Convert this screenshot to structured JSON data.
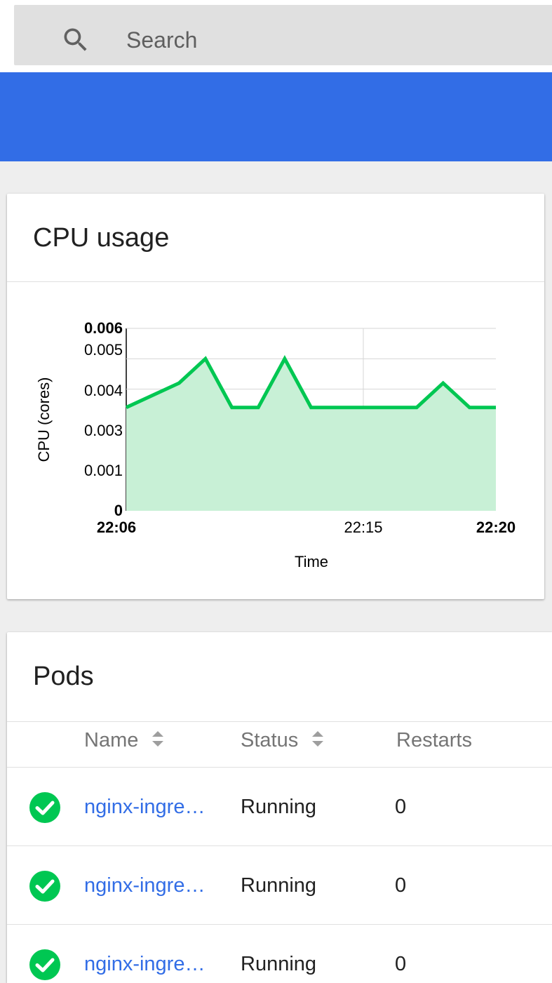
{
  "search": {
    "placeholder": "Search"
  },
  "colors": {
    "brand_blue": "#326de6",
    "ok_green": "#00c752",
    "area_fill": "#c8f0d6"
  },
  "cpu_card": {
    "title": "CPU usage"
  },
  "chart_data": {
    "type": "area",
    "title": "",
    "xlabel": "Time",
    "ylabel": "CPU (cores)",
    "x_ticks": [
      "22:06",
      "22:15",
      "22:20"
    ],
    "y_ticks": [
      "0",
      "0.001",
      "0.003",
      "0.004",
      "0.005",
      "0.006"
    ],
    "ylim": [
      0,
      0.006
    ],
    "grid": true,
    "series": [
      {
        "x": [
          "22:06",
          "22:08",
          "22:09",
          "22:10",
          "22:11",
          "22:12",
          "22:13",
          "22:14",
          "22:15",
          "22:16",
          "22:17",
          "22:18",
          "22:19",
          "22:20"
        ],
        "values": [
          0.0034,
          0.0042,
          0.005,
          0.0034,
          0.0034,
          0.005,
          0.0034,
          0.0034,
          0.0034,
          0.0034,
          0.0034,
          0.0042,
          0.0034,
          0.0034
        ]
      }
    ]
  },
  "pods_card": {
    "title": "Pods",
    "columns": [
      "Name",
      "Status",
      "Restarts"
    ],
    "rows": [
      {
        "name": "nginx-ingre…",
        "status": "Running",
        "restarts": "0"
      },
      {
        "name": "nginx-ingre…",
        "status": "Running",
        "restarts": "0"
      },
      {
        "name": "nginx-ingre…",
        "status": "Running",
        "restarts": "0"
      }
    ]
  }
}
